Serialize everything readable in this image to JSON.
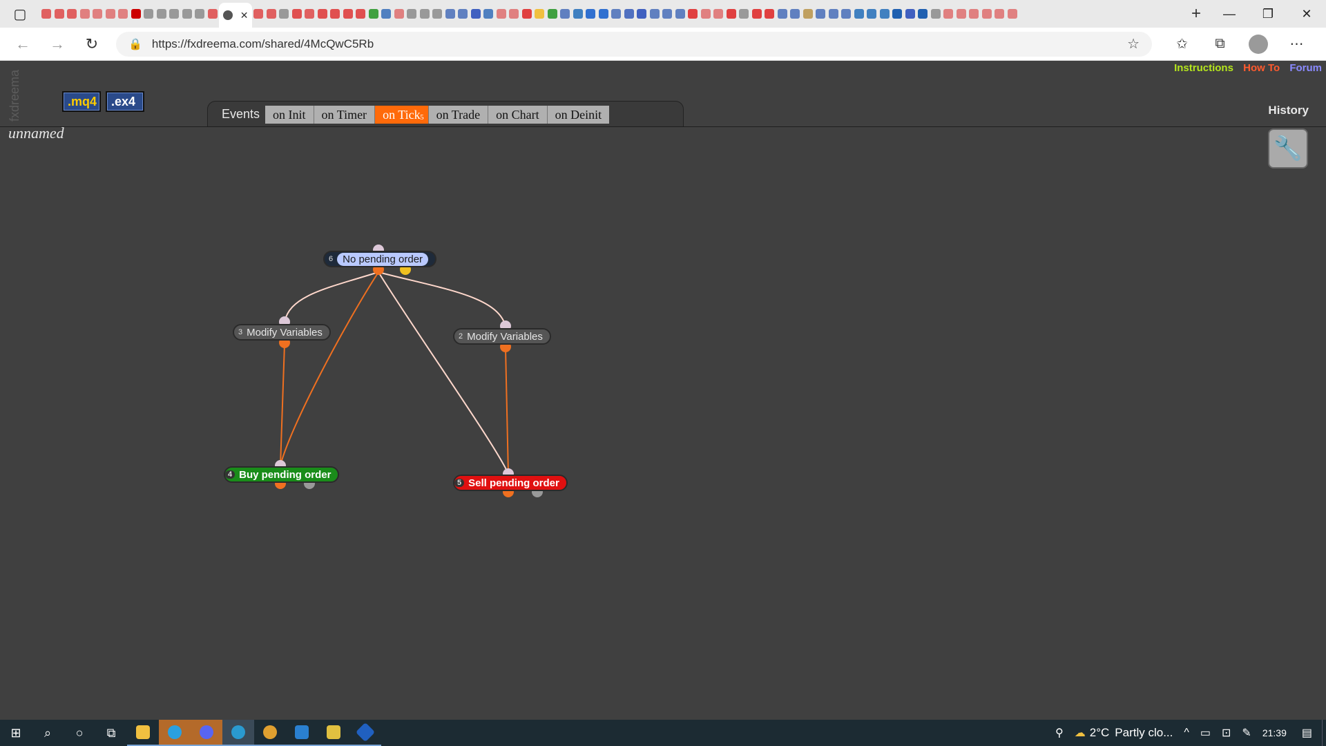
{
  "browser": {
    "url": "https://fxdreema.com/shared/4McQwC5Rb",
    "tab_colors": [
      "#e06060",
      "#e06060",
      "#e06060",
      "#e08080",
      "#e08080",
      "#e08080",
      "#e08080",
      "#cc0000",
      "#999999",
      "#999999",
      "#999999",
      "#999999",
      "#999999",
      "#e06060",
      "#e06060",
      "#e06060",
      "#999999",
      "#e05050",
      "#e06060",
      "#e05050",
      "#e05050",
      "#e05050",
      "#e05050",
      "#40a040",
      "#5080c0",
      "#e08080",
      "#999999",
      "#999999",
      "#999999",
      "#6080c0",
      "#6080c0",
      "#4060c0",
      "#5080c0",
      "#e08080",
      "#e08080",
      "#e04040",
      "#f0c040",
      "#40a040",
      "#6080c0",
      "#4080c0",
      "#3070d0",
      "#3070d0",
      "#6080c0",
      "#5070c0",
      "#4060c0",
      "#6080c0",
      "#6080c0",
      "#6080c0",
      "#e04040",
      "#e08080",
      "#e08080",
      "#e04040",
      "#999999",
      "#e04040",
      "#e04040",
      "#6080c0",
      "#6080c0",
      "#c0a060",
      "#6080c0",
      "#6080c0",
      "#6080c0",
      "#4080c0",
      "#4080c0",
      "#4080c0",
      "#2060b0",
      "#4060c0",
      "#2060b0",
      "#999999",
      "#e08080",
      "#e08080",
      "#e08080",
      "#e08080",
      "#e08080",
      "#e08080"
    ]
  },
  "app": {
    "brand_vertical": "fxdreema",
    "buttons": {
      "mq4": ".mq4",
      "ex4": ".ex4"
    },
    "project_title": "unnamed",
    "top_links": {
      "instructions": "Instructions",
      "howto": "How To",
      "forum": "Forum"
    },
    "history": "History",
    "events": {
      "label": "Events",
      "tabs": [
        {
          "label": "on Init"
        },
        {
          "label": "on Timer"
        },
        {
          "label": "on Tick",
          "badge": "5",
          "active": true
        },
        {
          "label": "on Trade"
        },
        {
          "label": "on Chart"
        },
        {
          "label": "on Deinit"
        }
      ]
    },
    "blocks": [
      {
        "id": "6",
        "label": "No pending order",
        "type": "cond"
      },
      {
        "id": "3",
        "label": "Modify Variables",
        "type": "mod"
      },
      {
        "id": "2",
        "label": "Modify Variables",
        "type": "mod"
      },
      {
        "id": "4",
        "label": "Buy pending order",
        "type": "buy"
      },
      {
        "id": "5",
        "label": "Sell pending order",
        "type": "sell"
      }
    ],
    "colors": {
      "instructions": "#b5e61d",
      "howto": "#ff5a2e",
      "forum": "#8a8aff",
      "active_tab": "#ff6a0a",
      "buy": "#1a8c1a",
      "sell": "#e01010",
      "connector_orange": "#f07020",
      "connector_yellow": "#f0c020",
      "connector_light": "#ffd8cc"
    }
  },
  "taskbar": {
    "weather_temp": "2°C",
    "weather_text": "Partly clo...",
    "time": "21:39"
  }
}
